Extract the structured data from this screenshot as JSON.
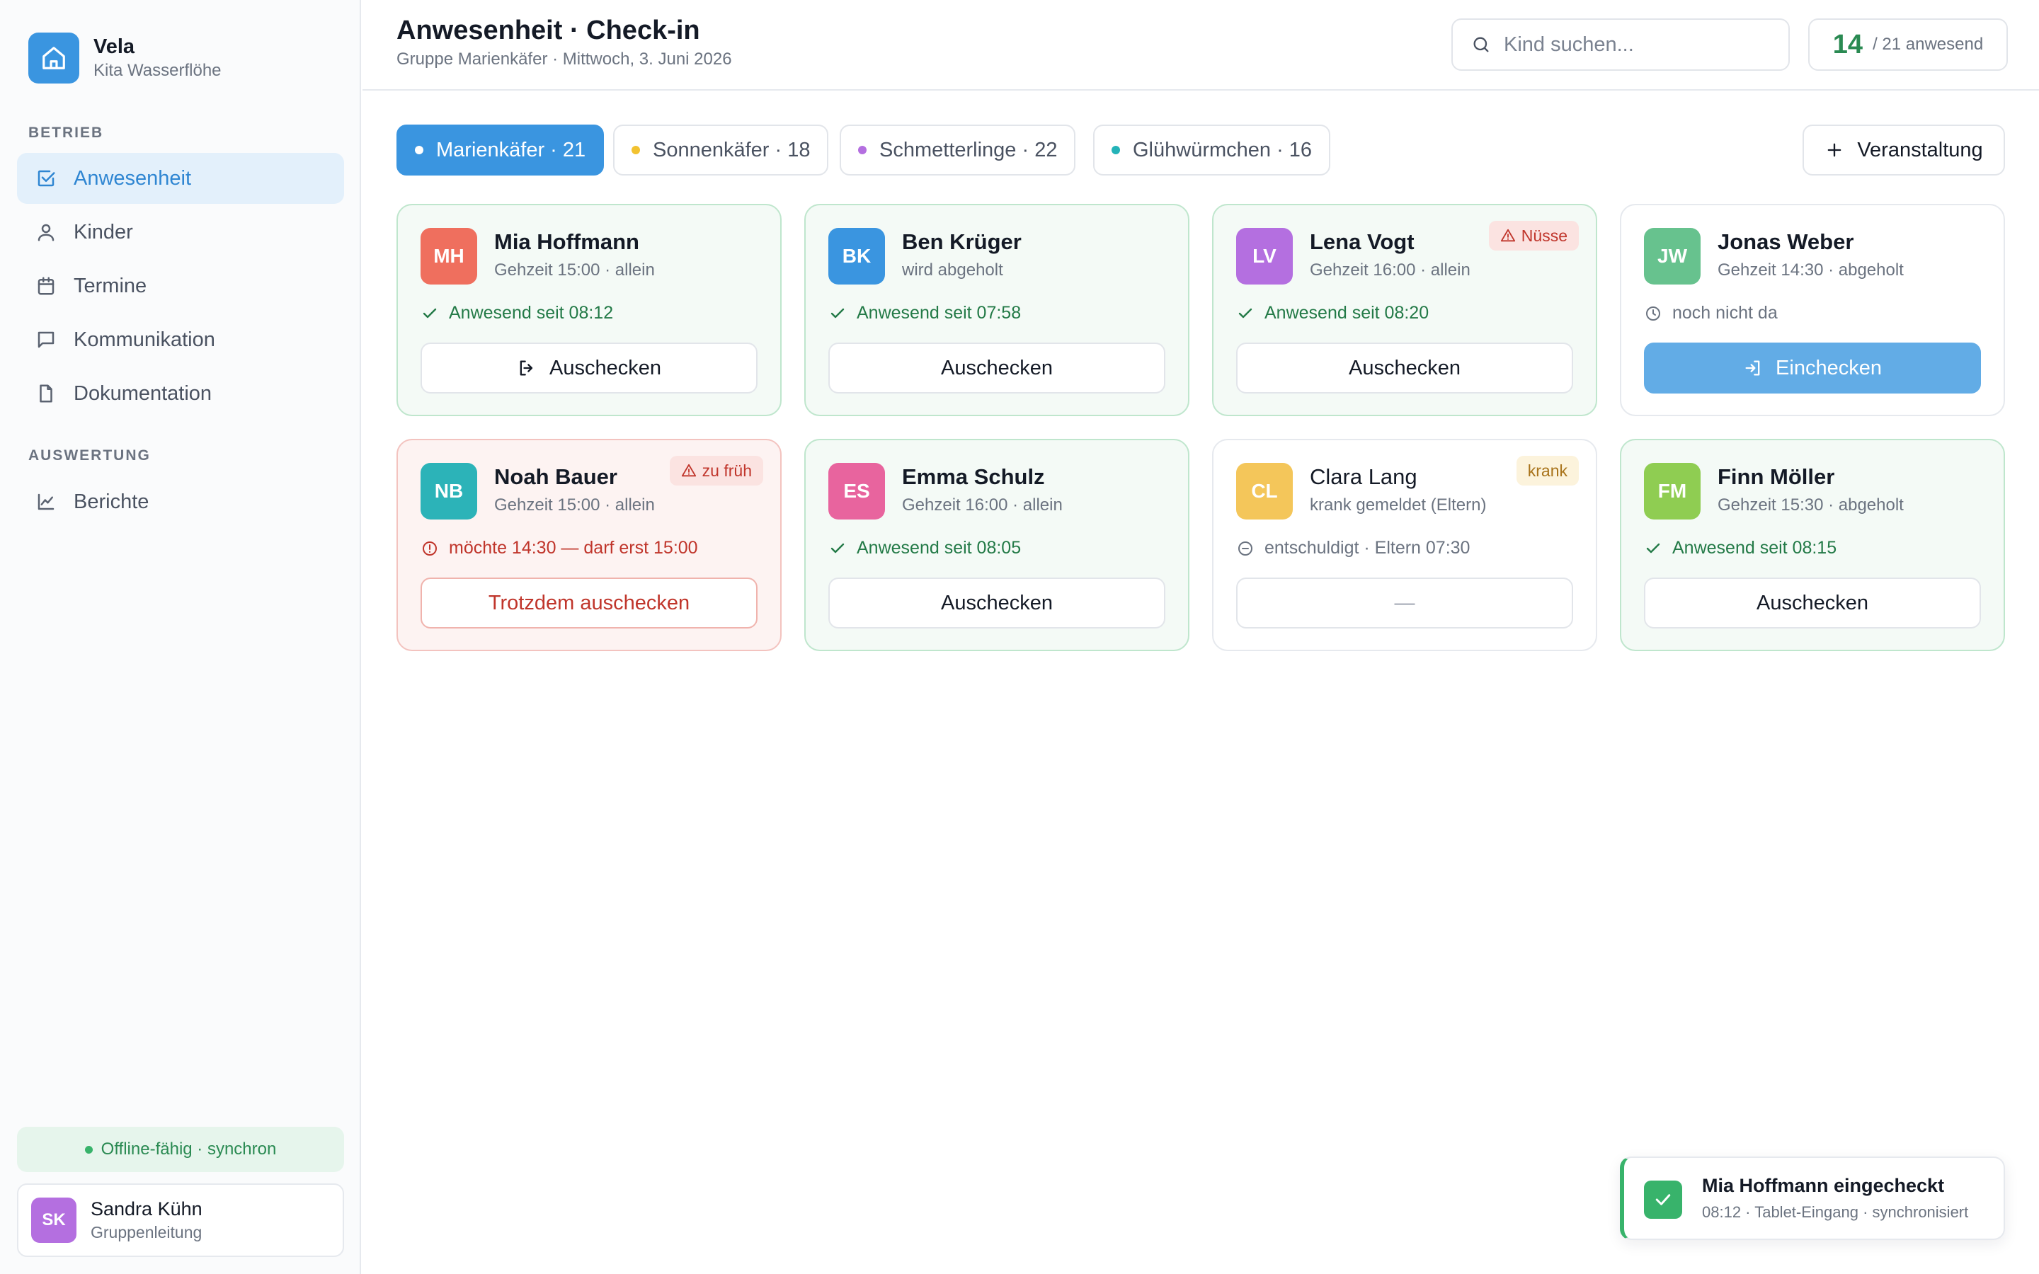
{
  "app": {
    "name": "Vela",
    "org": "Kita Wasserflöhe",
    "brand_color": "#3a95e0"
  },
  "sidebar": {
    "section_betrieb": "BETRIEB",
    "section_auswertung": "AUSWERTUNG",
    "items": [
      {
        "label": "Anwesenheit",
        "icon": "checkbox-icon",
        "active": true
      },
      {
        "label": "Kinder",
        "icon": "person-icon",
        "active": false
      },
      {
        "label": "Termine",
        "icon": "calendar-icon",
        "active": false
      },
      {
        "label": "Kommunikation",
        "icon": "chat-icon",
        "active": false
      },
      {
        "label": "Dokumentation",
        "icon": "document-icon",
        "active": false
      },
      {
        "label": "Berichte",
        "icon": "chart-icon",
        "active": false
      }
    ],
    "offline_status": "Offline-fähig · synchron",
    "user": {
      "initials": "SK",
      "name": "Sandra Kühn",
      "role": "Gruppenleitung"
    }
  },
  "header": {
    "title": "Anwesenheit · Check-in",
    "subtitle": "Gruppe Marienkäfer · Mittwoch, 3. Juni 2026",
    "search_placeholder": "Kind suchen...",
    "present_count": "14",
    "present_label": "/ 21 anwesend"
  },
  "tabs": [
    {
      "label": "Marienkäfer · 21",
      "dot": "#ffffff",
      "active": true
    },
    {
      "label": "Sonnenkäfer · 18",
      "dot": "#f2c230",
      "active": false
    },
    {
      "label": "Schmetterlinge · 22",
      "dot": "#b46fe0",
      "active": false
    },
    {
      "label": "Glühwürmchen · 16",
      "dot": "#24b3b8",
      "active": false
    }
  ],
  "event_button": "Veranstaltung",
  "cards": [
    {
      "initials": "MH",
      "name": "Mia Hoffmann",
      "meta": "Gehzeit 15:00 · allein",
      "status": "Anwesend seit 08:12",
      "button": "Auschecken",
      "badge": ""
    },
    {
      "initials": "BK",
      "name": "Ben Krüger",
      "meta": "wird abgeholt",
      "status": "Anwesend seit 07:58",
      "button": "Auschecken",
      "badge": ""
    },
    {
      "initials": "LV",
      "name": "Lena Vogt",
      "meta": "Gehzeit 16:00 · allein",
      "status": "Anwesend seit 08:20",
      "button": "Auschecken",
      "badge": "Nüsse"
    },
    {
      "initials": "JW",
      "name": "Jonas Weber",
      "meta": "Gehzeit 14:30 · abgeholt",
      "status": "noch nicht da",
      "button": "Einchecken",
      "badge": ""
    },
    {
      "initials": "NB",
      "name": "Noah Bauer",
      "meta": "Gehzeit 15:00 · allein",
      "status": "möchte 14:30 — darf erst 15:00",
      "button": "Trotzdem auschecken",
      "badge": "zu früh"
    },
    {
      "initials": "ES",
      "name": "Emma Schulz",
      "meta": "Gehzeit 16:00 · allein",
      "status": "Anwesend seit 08:05",
      "button": "Auschecken",
      "badge": ""
    },
    {
      "initials": "CL",
      "name": "Clara Lang",
      "meta": "krank gemeldet (Eltern)",
      "status": "entschuldigt · Eltern 07:30",
      "button": "—",
      "badge": "krank"
    },
    {
      "initials": "FM",
      "name": "Finn Möller",
      "meta": "Gehzeit 15:30 · abgeholt",
      "status": "Anwesend seit 08:15",
      "button": "Auschecken",
      "badge": ""
    }
  ],
  "avatar_colors": {
    "MH": "#ef6f5e",
    "BK": "#3a95e0",
    "LV": "#b46fe0",
    "JW": "#67c28e",
    "NB": "#2cb3b8",
    "ES": "#e8649e",
    "CL": "#f4c65a",
    "FM": "#8fcd52"
  },
  "toast": {
    "title": "Mia Hoffmann eingecheckt",
    "subtitle": "08:12 · Tablet-Eingang · synchronisiert"
  }
}
